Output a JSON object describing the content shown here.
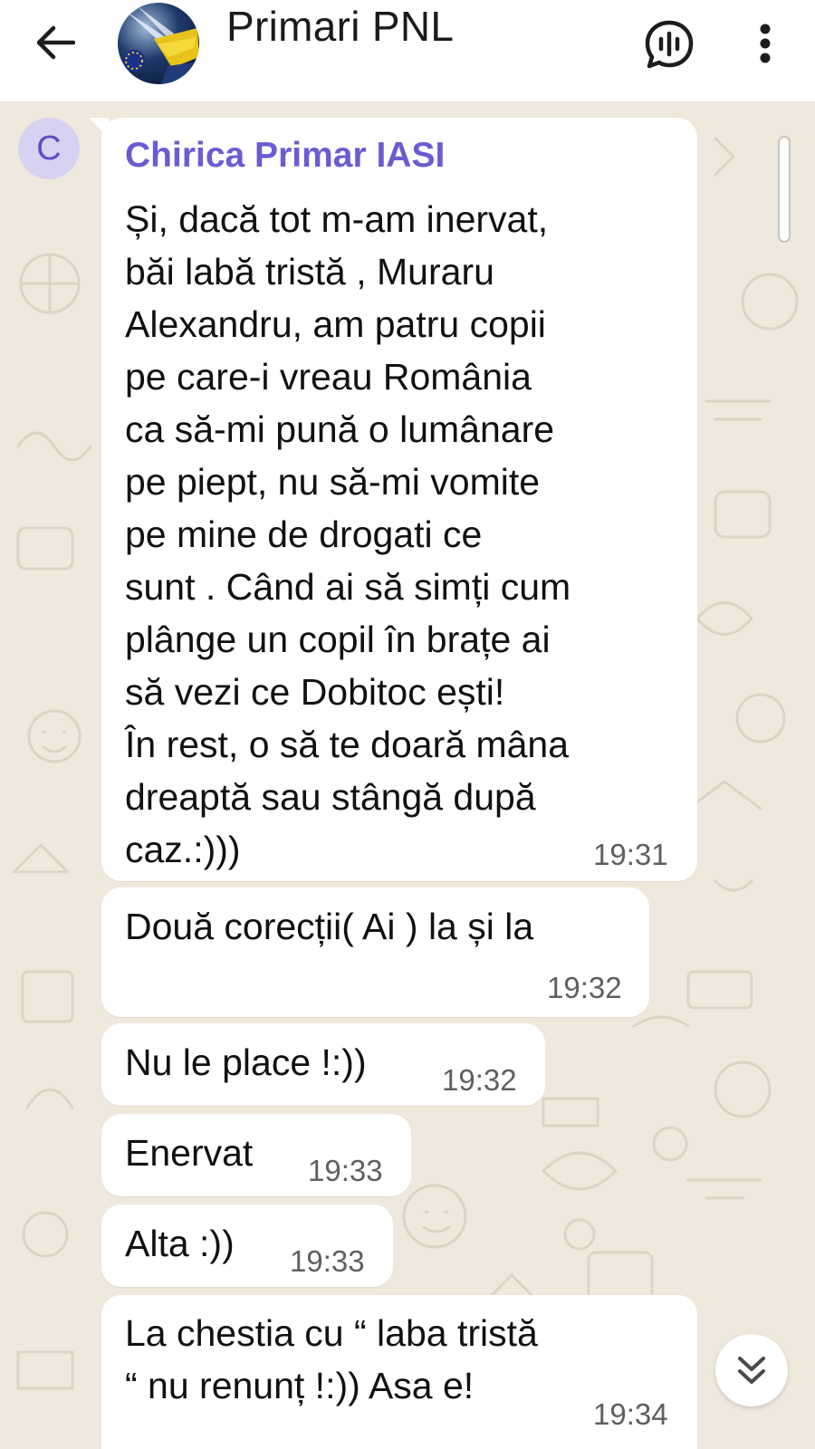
{
  "header": {
    "title": "Primari PNL",
    "back_icon": "arrow-left-icon",
    "voice_icon": "voice-chat-icon",
    "menu_icon": "more-vertical-icon"
  },
  "sender": {
    "initial": "C",
    "name": "Chirica Primar IASI",
    "name_color": "#6a5cd2"
  },
  "messages": [
    {
      "text": "Și, dacă tot m-am inervat,\nbăi labă tristă , Muraru\nAlexandru, am patru copii\npe care-i vreau România\nca să-mi pună o lumânare\npe piept, nu să-mi vomite\npe mine de drogati ce\nsunt . Când ai să simți cum\nplânge un copil în brațe ai\nsă vezi ce Dobitoc ești!\nÎn rest, o să te doară mâna\ndreaptă sau stângă după\ncaz.:)))",
      "time": "19:31"
    },
    {
      "text": "Două corecții(  Ai ) la și la",
      "time": "19:32"
    },
    {
      "text": "Nu le place !:))",
      "time": "19:32"
    },
    {
      "text": "Enervat",
      "time": "19:33"
    },
    {
      "text": "Alta :))",
      "time": "19:33"
    },
    {
      "text": "La chestia cu “ laba tristă\n“ nu renunț !:)) Asa e!",
      "time": "19:34"
    }
  ],
  "colors": {
    "background": "#efe8dc",
    "bubble": "#ffffff",
    "accent": "#6a5cd2"
  },
  "scroll_down_icon": "double-chevron-down-icon"
}
